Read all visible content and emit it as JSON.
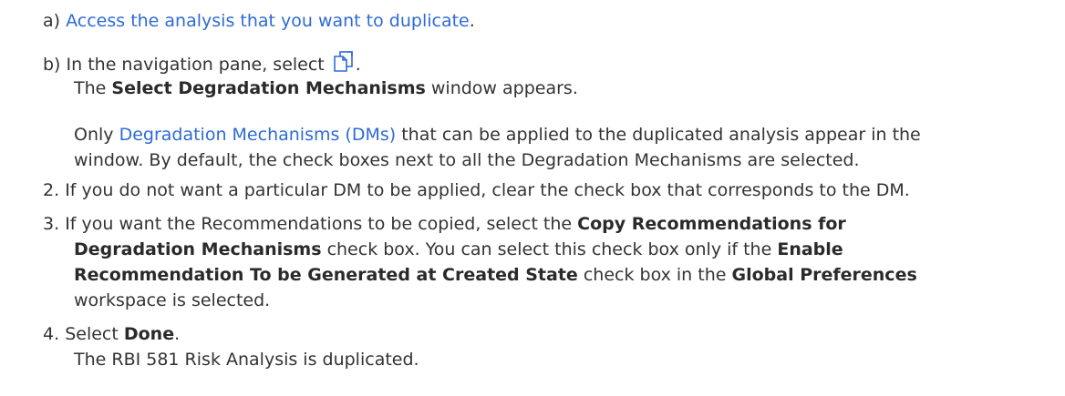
{
  "substeps": [
    {
      "marker": "a)",
      "link": "Access the analysis that you want to duplicate",
      "trail": "."
    },
    {
      "marker": "b)",
      "text": "In the navigation pane, select",
      "icon": "duplicate-icon",
      "trail": ".",
      "result_pre": "The ",
      "result_bold": "Select Degradation Mechanisms",
      "result_post": " window appears.",
      "note_link": "Degradation Mechanisms (DMs)",
      "note_text_1": "Only ",
      "note_text_2": " that can be applied to the duplicated analysis appear in the",
      "note_line_2": "window. By default, the check boxes next to all the Degradation Mechanisms are selected."
    }
  ],
  "steps": [
    {
      "number": "2.",
      "text": "If you do not want a particular DM to be applied, clear the check box that corresponds to the DM."
    },
    {
      "number": "3.",
      "l1_pre": "If you want the Recommendations to be copied, select the ",
      "l1_bold": "Copy Recommendations for",
      "l2_bold": "Degradation Mechanisms",
      "l2_post": " check box. You can select this check box only if the ",
      "l2_bold2": "Enable",
      "l3_bold": "Recommendation To be Generated at Created State",
      "l3_mid": " check box in the ",
      "l3_bold2": "Global Preferences",
      "l4": "workspace is selected."
    },
    {
      "number": "4.",
      "pre": "Select ",
      "bold": "Done",
      "post": ".",
      "result": "The RBI 581 Risk Analysis is duplicated."
    }
  ],
  "colors": {
    "link": "#2d6bd6",
    "text": "#333333",
    "icon": "#2d6bd6"
  }
}
